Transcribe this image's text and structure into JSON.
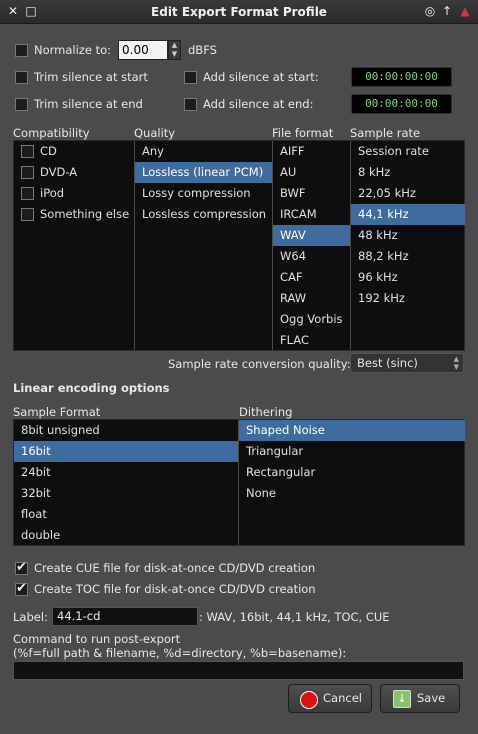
{
  "window": {
    "title": "Edit Export Format Profile"
  },
  "normalize": {
    "label": "Normalize to:",
    "value": "0.00",
    "unit": "dBFS",
    "checked": false
  },
  "trim_start": {
    "label": "Trim silence at start",
    "checked": false
  },
  "trim_end": {
    "label": "Trim silence at end",
    "checked": false
  },
  "add_start": {
    "label": "Add silence at start:",
    "checked": false,
    "time": "00:00:00:00"
  },
  "add_end": {
    "label": "Add silence at end:",
    "checked": false,
    "time": "00:00:00:00"
  },
  "compatibility": {
    "header": "Compatibility",
    "items": [
      {
        "label": "CD"
      },
      {
        "label": "DVD-A"
      },
      {
        "label": "iPod"
      },
      {
        "label": "Something else"
      }
    ]
  },
  "quality": {
    "header": "Quality",
    "items": [
      "Any",
      "Lossless (linear PCM)",
      "Lossy compression",
      "Lossless compression"
    ],
    "selected": "Lossless (linear PCM)"
  },
  "file_format": {
    "header": "File format",
    "items": [
      "AIFF",
      "AU",
      "BWF",
      "IRCAM",
      "WAV",
      "W64",
      "CAF",
      "RAW",
      "Ogg Vorbis",
      "FLAC"
    ],
    "selected": "WAV"
  },
  "sample_rate": {
    "header": "Sample rate",
    "items": [
      "Session rate",
      "8 kHz",
      "22,05 kHz",
      "44,1 kHz",
      "48 kHz",
      "88,2 kHz",
      "96 kHz",
      "192 kHz"
    ],
    "selected": "44,1 kHz"
  },
  "src_quality": {
    "label": "Sample rate conversion quality:",
    "value": "Best (sinc)"
  },
  "linear_options": {
    "title": "Linear encoding options"
  },
  "sample_format": {
    "header": "Sample Format",
    "items": [
      "8bit unsigned",
      "16bit",
      "24bit",
      "32bit",
      "float",
      "double"
    ],
    "selected": "16bit"
  },
  "dithering": {
    "header": "Dithering",
    "items": [
      "Shaped Noise",
      "Triangular",
      "Rectangular",
      "None"
    ],
    "selected": "Shaped Noise"
  },
  "cue": {
    "label": "Create CUE file for disk-at-once CD/DVD creation",
    "checked": true
  },
  "toc": {
    "label": "Create TOC file for disk-at-once CD/DVD creation",
    "checked": true
  },
  "label_field": {
    "label": "Label:",
    "value": "44.1-cd",
    "summary": ": WAV, 16bit, 44,1 kHz, TOC, CUE"
  },
  "command": {
    "label_line1": "Command to run post-export",
    "label_line2": "(%f=full path & filename, %d=directory, %b=basename):",
    "value": ""
  },
  "buttons": {
    "cancel": "Cancel",
    "save": "Save"
  },
  "colors": {
    "selection": "#3f6c9e",
    "time_text": "#7fd67f"
  }
}
